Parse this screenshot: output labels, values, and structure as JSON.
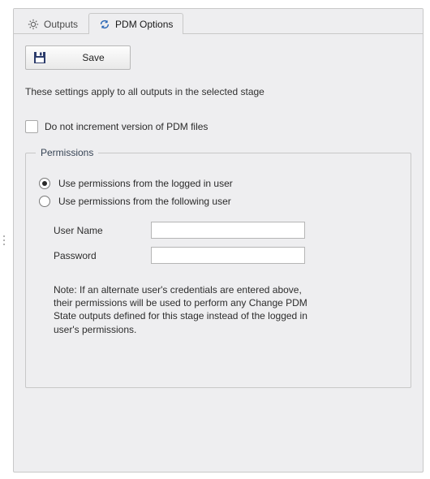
{
  "tabs": {
    "outputs_label": "Outputs",
    "pdm_options_label": "PDM Options"
  },
  "toolbar": {
    "save_label": "Save"
  },
  "description": "These settings apply to all outputs in the selected stage",
  "options": {
    "no_increment_label": "Do not increment version of PDM files",
    "no_increment_checked": false
  },
  "permissions": {
    "legend": "Permissions",
    "radio_logged_label": "Use permissions from the logged in user",
    "radio_following_label": "Use permissions from the following user",
    "selected": "logged",
    "username_label": "User Name",
    "username_value": "",
    "password_label": "Password",
    "password_value": "",
    "note": "Note: If an alternate user's credentials are entered above, their permissions will be used to perform any Change PDM State outputs defined for this stage instead of the logged in user's permissions."
  }
}
